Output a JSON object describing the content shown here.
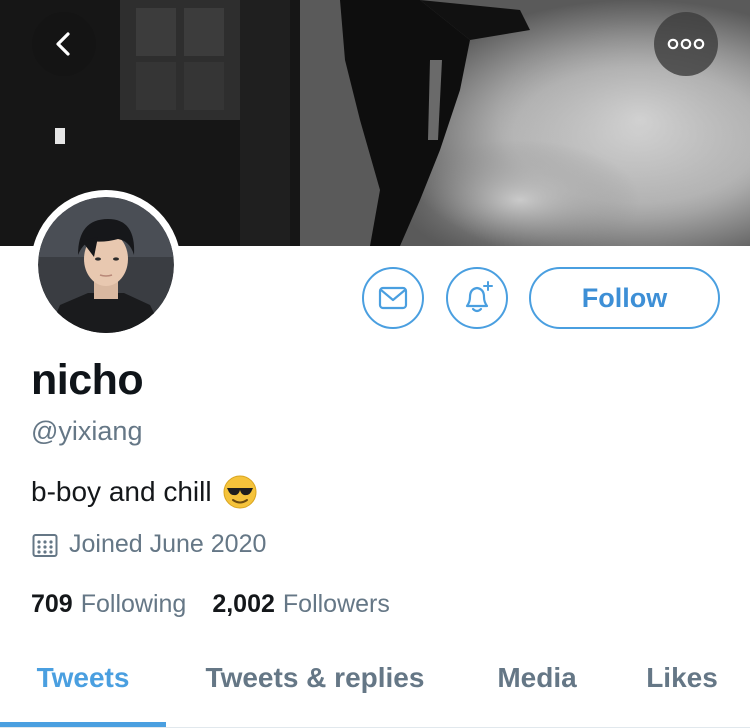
{
  "header": {
    "back_icon": "chevron-left-icon",
    "more_icon": "more-horizontal-icon"
  },
  "profile": {
    "display_name": "nicho",
    "handle": "@yixiang",
    "bio": "b-boy and chill",
    "bio_emoji": "smiling-face-with-sunglasses",
    "joined": "Joined June 2020",
    "following_count": "709",
    "following_label": "Following",
    "followers_count": "2,002",
    "followers_label": "Followers"
  },
  "actions": {
    "message_icon": "envelope-icon",
    "notify_icon": "bell-plus-icon",
    "follow_label": "Follow"
  },
  "tabs": [
    {
      "label": "Tweets",
      "active": true
    },
    {
      "label": "Tweets & replies",
      "active": false
    },
    {
      "label": "Media",
      "active": false
    },
    {
      "label": "Likes",
      "active": false
    }
  ],
  "colors": {
    "accent": "#4a9fe0",
    "secondary_text": "#657786",
    "primary_text": "#14171a"
  }
}
